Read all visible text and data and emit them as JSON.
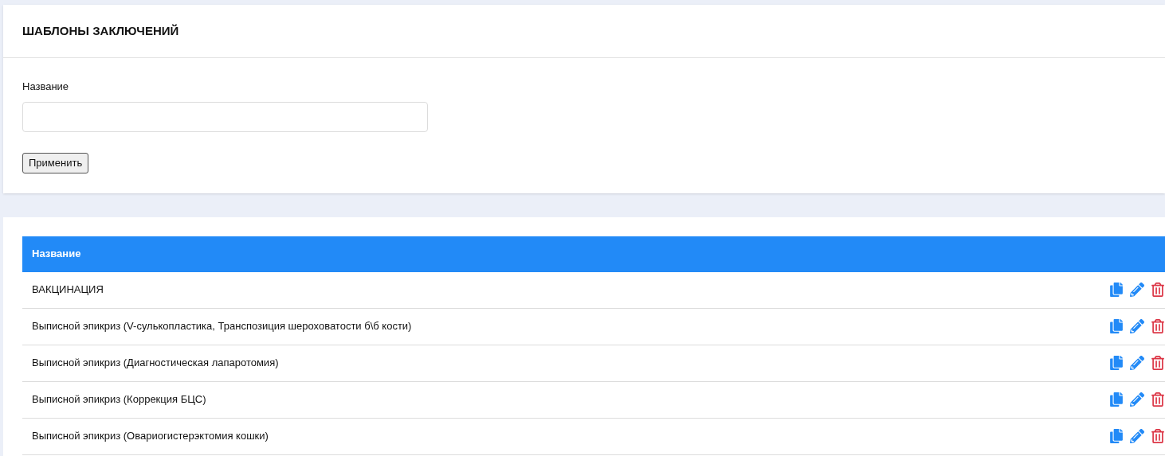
{
  "page_title": "ШАБЛОНЫ ЗАКЛЮЧЕНИЙ",
  "filter": {
    "label": "Название",
    "button": "Применить"
  },
  "table": {
    "columns": [
      "Название"
    ],
    "rows": [
      {
        "name": "ВАКЦИНАЦИЯ"
      },
      {
        "name": "Выписной эпикриз (V-сулькопластика, Транспозиция шероховатости б\\б кости)"
      },
      {
        "name": "Выписной эпикриз (Диагностическая лапаротомия)"
      },
      {
        "name": "Выписной эпикриз (Коррекция БЦС)"
      },
      {
        "name": "Выписной эпикриз (Овариогистерэктомия кошки)"
      }
    ]
  }
}
